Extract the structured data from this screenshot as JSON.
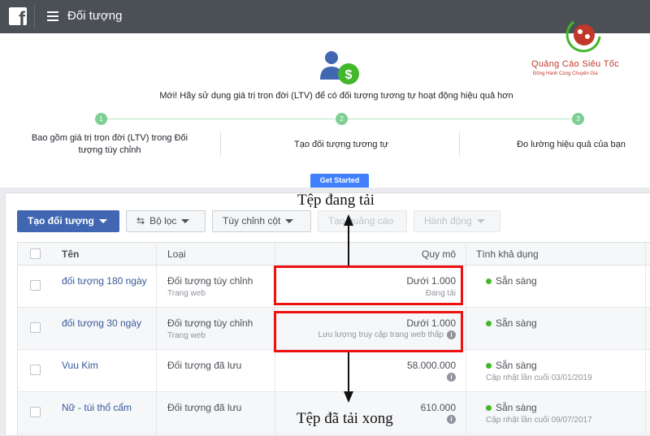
{
  "topbar": {
    "logo": "f",
    "title": "Đối tượng",
    "menu_icon": "hamburger-icon"
  },
  "promo": {
    "icon": "person-dollar-icon",
    "headline": "Mới! Hãy sử dụng giá trị trọn đời (LTV) để có đối tượng tương tự hoạt động hiệu quả hơn",
    "steps": [
      {
        "num": "1",
        "label": "Bao gồm giá trị trọn đời (LTV) trong Đối tượng tùy chỉnh"
      },
      {
        "num": "2",
        "label": "Tạo đối tượng tương tự"
      },
      {
        "num": "3",
        "label": "Đo lường hiệu quả của bạn"
      }
    ],
    "cta": "Get Started"
  },
  "watermark": {
    "title": "Quảng Cáo Siêu Tốc",
    "subtitle": "Đồng Hành Cùng Chuyên Gia"
  },
  "toolbar": {
    "create_label": "Tạo đối tượng",
    "filter_label": "Bộ lọc",
    "columns_label": "Tùy chỉnh cột",
    "create_ad_label": "Tạo quảng cáo",
    "actions_label": "Hành động"
  },
  "table": {
    "headers": {
      "name": "Tên",
      "type": "Loại",
      "size": "Quy mô",
      "availability": "Tình khả dụng"
    },
    "rows": [
      {
        "name": "đối tượng 180 ngày",
        "type": "Đối tượng tùy chỉnh",
        "type_sub": "Trang web",
        "size": "Dưới 1.000",
        "size_sub": "Đang tải",
        "availability": "Sẵn sàng",
        "availability_sub": ""
      },
      {
        "name": "đối tượng 30 ngày",
        "type": "Đối tượng tùy chỉnh",
        "type_sub": "Trang web",
        "size": "Dưới 1.000",
        "size_sub": "Lưu lượng truy cập trang web thấp",
        "availability": "Sẵn sàng",
        "availability_sub": ""
      },
      {
        "name": "Vuu Kim",
        "type": "Đối tượng đã lưu",
        "type_sub": "",
        "size": "58.000.000",
        "size_sub": "",
        "availability": "Sẵn sàng",
        "availability_sub": "Cập nhật lần cuối 03/01/2019"
      },
      {
        "name": "Nữ - túi thổ cẩm",
        "type": "Đối tượng đã lưu",
        "type_sub": "",
        "size": "610.000",
        "size_sub": "",
        "availability": "Sẵn sàng",
        "availability_sub": "Cập nhật lần cuối 09/07/2017"
      }
    ]
  },
  "annotations": {
    "top": "Tệp đang tải",
    "bottom": "Tệp đã tải xong",
    "highlight_color": "#ee1111"
  },
  "colors": {
    "topbar": "#4b4f56",
    "primary": "#4267b2",
    "link": "#365899",
    "ready": "#42b72a",
    "step": "#7fcf94"
  }
}
